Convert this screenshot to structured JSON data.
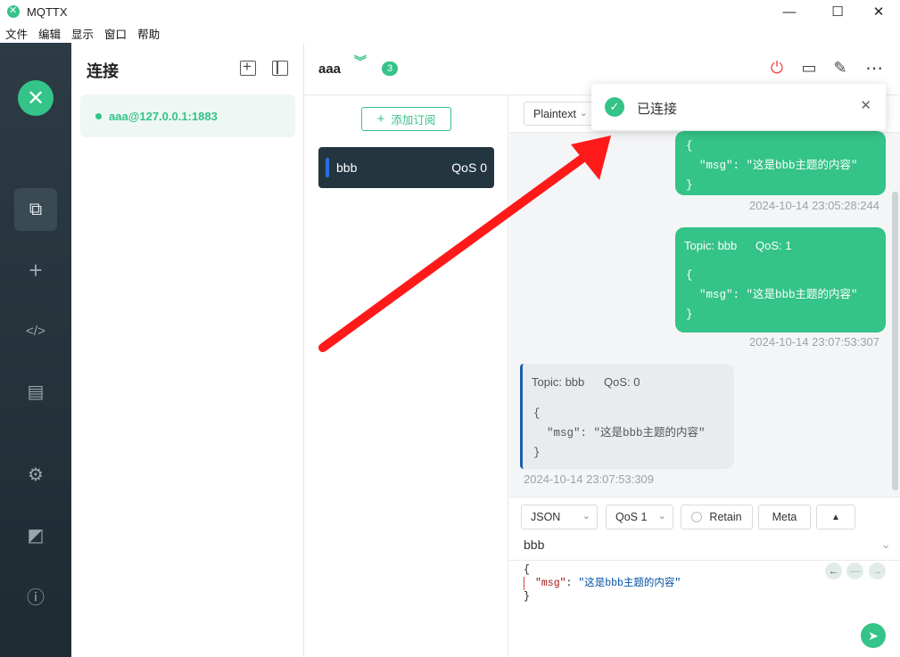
{
  "window": {
    "title": "MQTTX",
    "minimize": "—",
    "maximize": "☐",
    "close": "✕"
  },
  "menu": [
    "文件",
    "编辑",
    "显示",
    "窗口",
    "帮助"
  ],
  "sidebar": {
    "brand": "✕",
    "items": [
      {
        "name": "connections-icon",
        "glyph": "⧉"
      },
      {
        "name": "plus-icon",
        "glyph": "+"
      },
      {
        "name": "code-icon",
        "glyph": "</>"
      },
      {
        "name": "log-icon",
        "glyph": "▤"
      },
      {
        "name": "settings-icon",
        "glyph": "⚙"
      },
      {
        "name": "rss-icon",
        "glyph": "◩"
      },
      {
        "name": "info-icon",
        "glyph": "ⓘ"
      }
    ]
  },
  "connections": {
    "heading": "连接",
    "items": [
      {
        "label": "aaa@127.0.0.1:1883"
      }
    ]
  },
  "header": {
    "connection_name": "aaa",
    "chevrons": "︾",
    "count": "3",
    "tools": {
      "power": "⏻",
      "chat": "▭",
      "edit": "✎",
      "more": "⋯"
    }
  },
  "subscriptions": {
    "add_label": "添加订阅",
    "add_plus": "+",
    "items": [
      {
        "topic": "bbb",
        "qos": "QoS 0"
      }
    ]
  },
  "messages": {
    "format": "Plaintext",
    "list": [
      {
        "direction": "out",
        "code": "{\n  \"msg\": \"这是bbb主题的内容\"\n}",
        "time": "2024-10-14 23:05:28:244"
      },
      {
        "direction": "out",
        "topic": "Topic: bbb",
        "qos": "QoS: 1",
        "code": "{\n  \"msg\": \"这是bbb主题的内容\"\n}",
        "time": "2024-10-14 23:07:53:307"
      },
      {
        "direction": "in",
        "topic": "Topic: bbb",
        "qos": "QoS: 0",
        "code": "{\n  \"msg\": \"这是bbb主题的内容\"\n}",
        "time": "2024-10-14 23:07:53:309"
      }
    ]
  },
  "publish": {
    "format": "JSON",
    "qos": "QoS 1",
    "retain": "Retain",
    "meta": "Meta",
    "expand": "▲",
    "topic": "bbb",
    "payload_open": "{",
    "payload_key": "\"msg\"",
    "payload_sep": ": ",
    "payload_value": "\"这是bbb主题的内容\"",
    "payload_close": "}",
    "history_prev": "←",
    "history_reset": "—",
    "history_next": "→",
    "send": "➤"
  },
  "toast": {
    "text": "已连接",
    "icon": "✓",
    "close": "✕"
  },
  "colors": {
    "accent": "#34c388",
    "sidebar": "#26343c",
    "annotation": "#ff1a1a"
  }
}
